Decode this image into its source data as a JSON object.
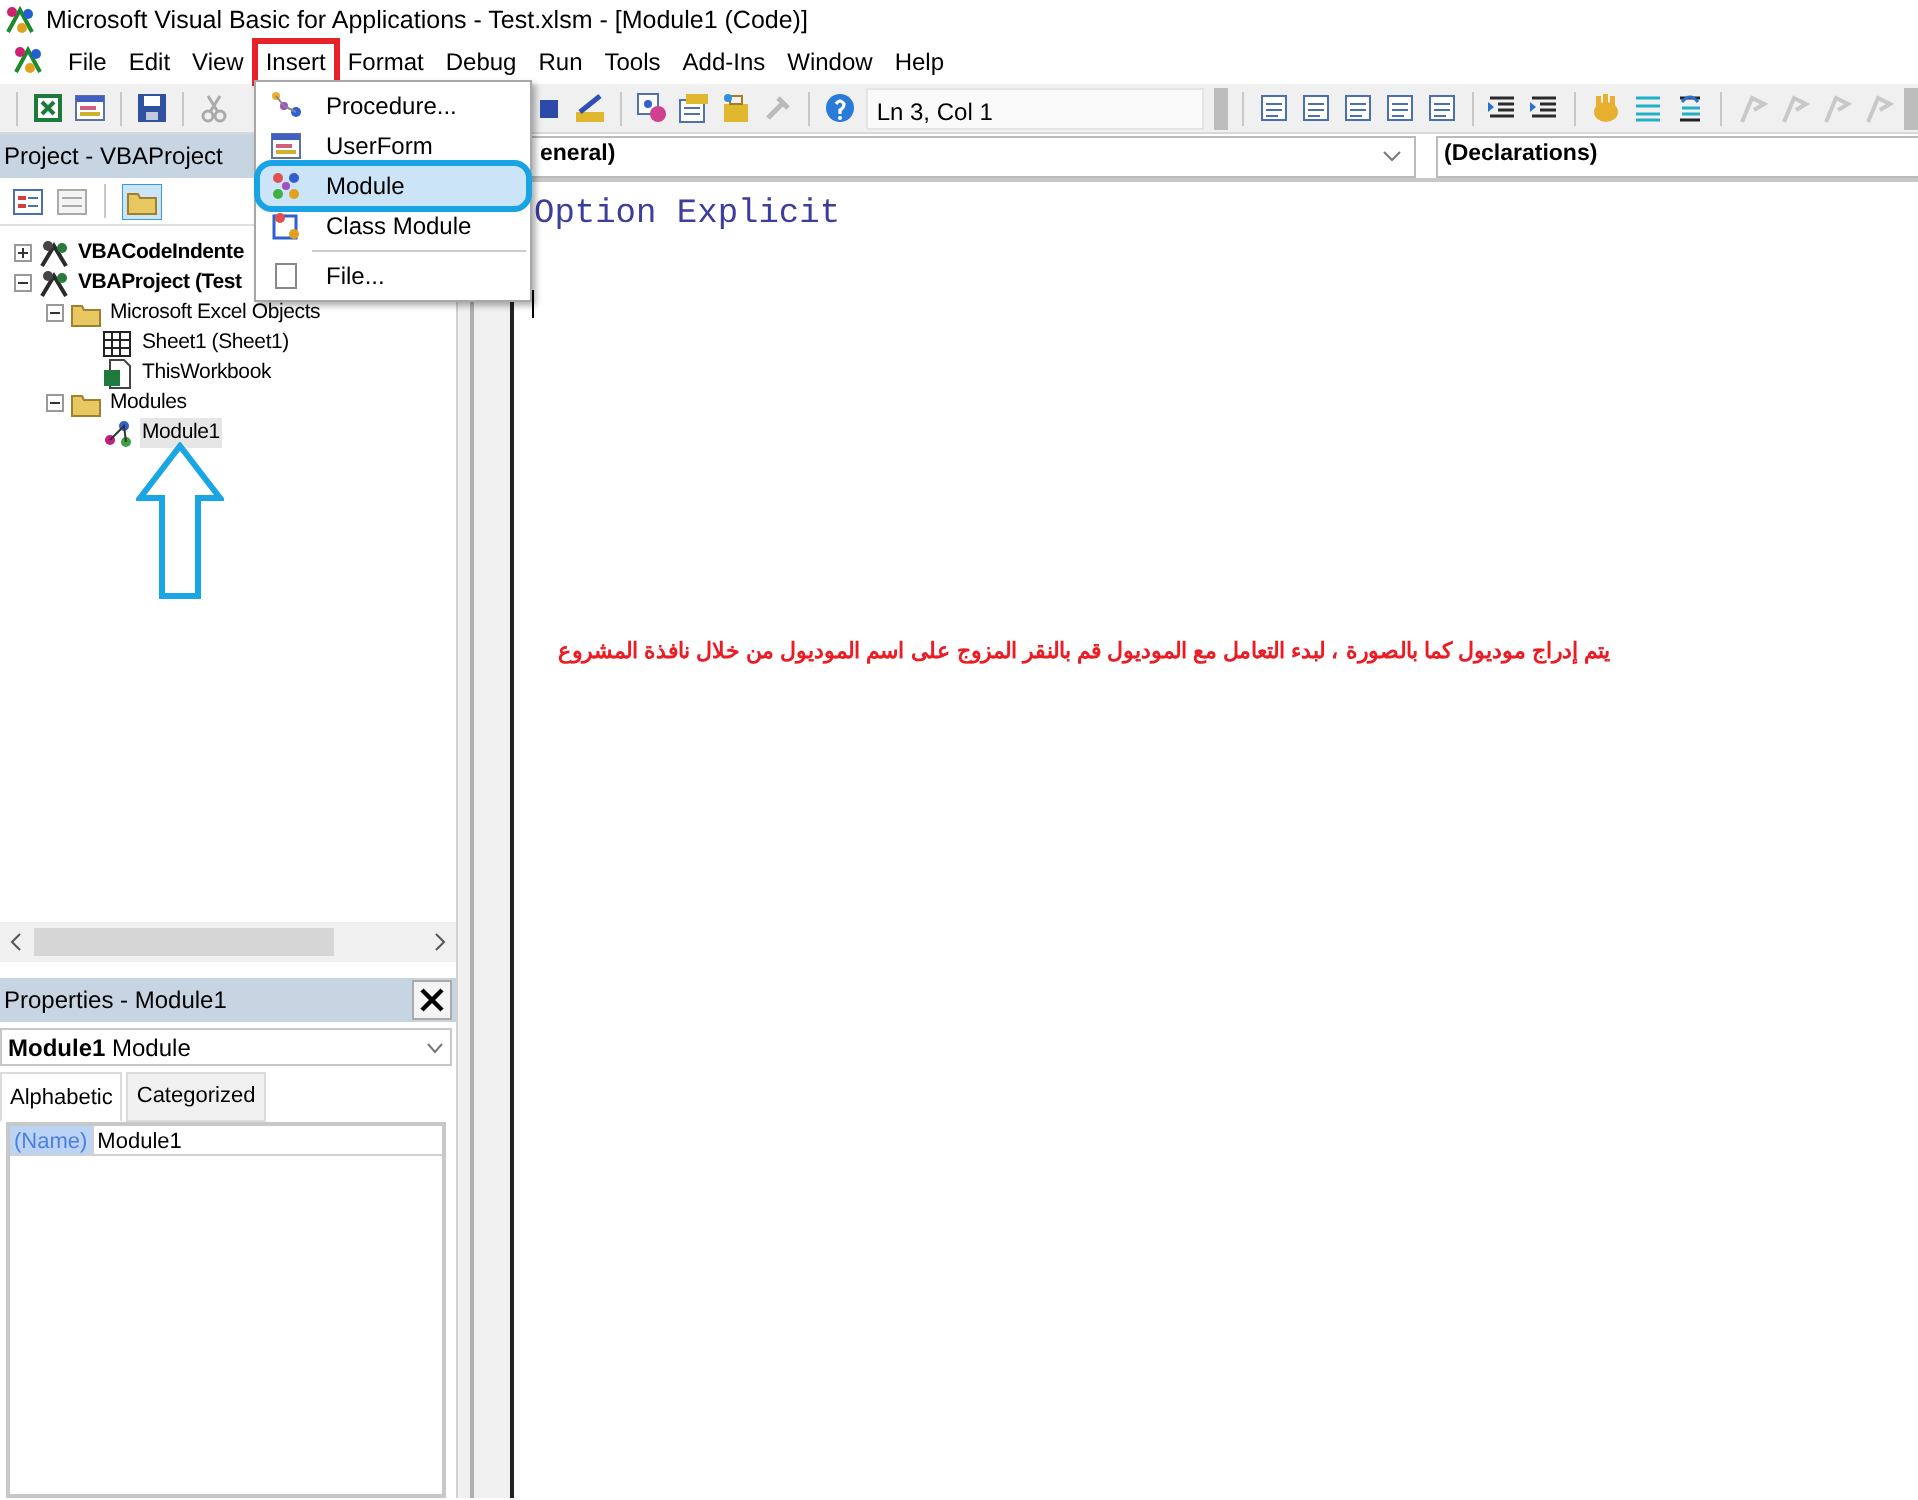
{
  "window": {
    "title": "Microsoft Visual Basic for Applications - Test.xlsm - [Module1 (Code)]"
  },
  "menu_bar": [
    {
      "label": "File",
      "selected": false
    },
    {
      "label": "Edit",
      "selected": false
    },
    {
      "label": "View",
      "selected": false
    },
    {
      "label": "Insert",
      "selected": true
    },
    {
      "label": "Format",
      "selected": false
    },
    {
      "label": "Debug",
      "selected": false
    },
    {
      "label": "Run",
      "selected": false
    },
    {
      "label": "Tools",
      "selected": false
    },
    {
      "label": "Add-Ins",
      "selected": false
    },
    {
      "label": "Window",
      "selected": false
    },
    {
      "label": "Help",
      "selected": false
    }
  ],
  "toolbar": {
    "position": "Ln 3, Col 1"
  },
  "insert_menu": [
    {
      "label": "Procedure...",
      "kind": "procedure",
      "highlighted": false
    },
    {
      "label": "UserForm",
      "kind": "userform",
      "highlighted": false
    },
    {
      "label": "Module",
      "kind": "module",
      "highlighted": true
    },
    {
      "label": "Class Module",
      "kind": "class",
      "highlighted": false
    },
    {
      "label": "File...",
      "kind": "file",
      "highlighted": false
    }
  ],
  "project_panel": {
    "title": "Project - VBAProject",
    "tree": [
      {
        "label": "VBACodeIndente",
        "kind": "project",
        "expanded": false,
        "selected": false
      },
      {
        "label": "VBAProject (Test",
        "kind": "project",
        "expanded": true,
        "selected": false,
        "children": [
          {
            "label": "Microsoft Excel Objects",
            "kind": "folder",
            "expanded": true,
            "selected": false,
            "children": [
              {
                "label": "Sheet1 (Sheet1)",
                "kind": "sheet",
                "selected": false
              },
              {
                "label": "ThisWorkbook",
                "kind": "workbook",
                "selected": false
              }
            ]
          },
          {
            "label": "Modules",
            "kind": "folder",
            "expanded": true,
            "selected": false,
            "children": [
              {
                "label": "Module1",
                "kind": "module",
                "selected": true
              }
            ]
          }
        ]
      }
    ]
  },
  "properties_panel": {
    "title": "Properties - Module1",
    "object_name": "Module1",
    "object_type": "Module",
    "tabs": [
      {
        "label": "Alphabetic",
        "selected": true
      },
      {
        "label": "Categorized",
        "selected": false
      }
    ],
    "rows": [
      {
        "name": "(Name)",
        "value": "Module1",
        "selected": true
      }
    ]
  },
  "code_window": {
    "object": "eneral)",
    "procedure": "(Declarations)",
    "lines": [
      "Option Explicit"
    ]
  },
  "annotation": "يتم إدراج موديول كما بالصورة ، لبدء التعامل مع الموديول قم بالنقر المزوج على اسم الموديول من خلال نافذة المشروع"
}
